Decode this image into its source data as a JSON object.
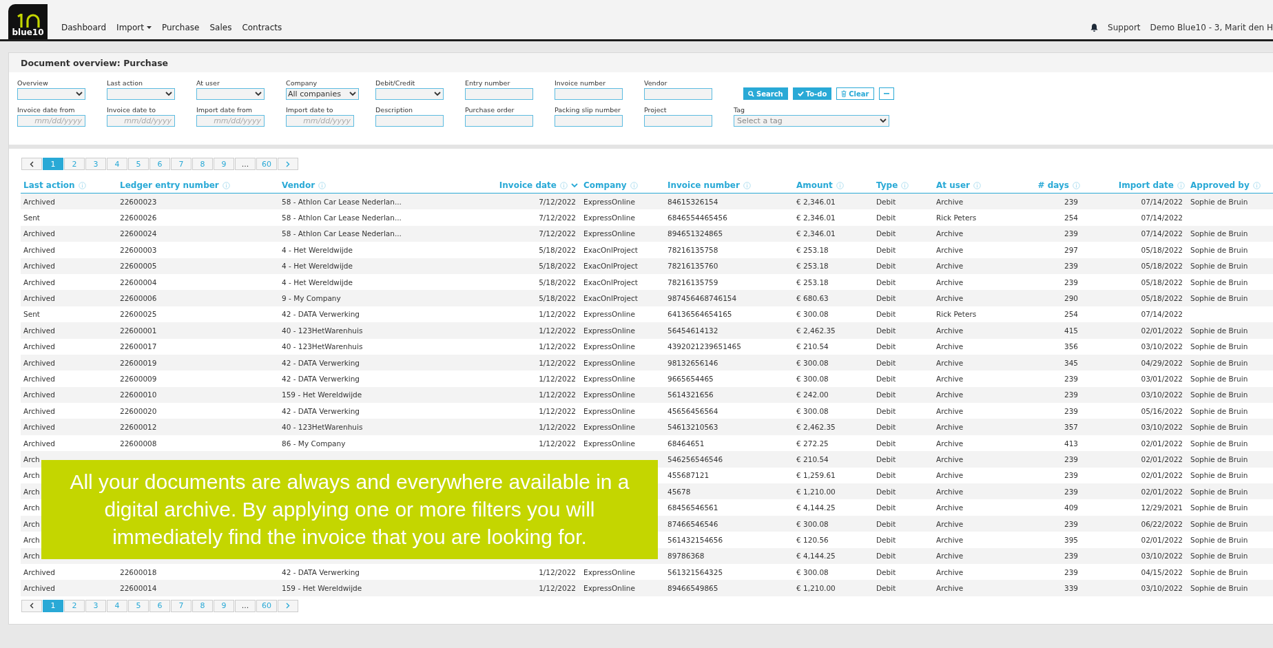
{
  "header": {
    "logo_text": "blue10",
    "nav": [
      {
        "label": "Dashboard",
        "kind": "link"
      },
      {
        "label": "Import",
        "kind": "dropdown"
      },
      {
        "label": "Purchase",
        "kind": "link"
      },
      {
        "label": "Sales",
        "kind": "link"
      },
      {
        "label": "Contracts",
        "kind": "link"
      }
    ],
    "support": "Support",
    "user": "Demo Blue10 - 3, Marit den H"
  },
  "panel_title": "Document overview: Purchase",
  "filter_rows": [
    [
      {
        "label": "Overview",
        "kind": "select"
      },
      {
        "label": "Last action",
        "kind": "select"
      },
      {
        "label": "At user",
        "kind": "select"
      },
      {
        "label": "Company",
        "kind": "select",
        "value": "All companies"
      },
      {
        "label": "Debit/Credit",
        "kind": "select"
      },
      {
        "label": "Entry number",
        "kind": "text"
      },
      {
        "label": "Invoice number",
        "kind": "text"
      },
      {
        "label": "Vendor",
        "kind": "text"
      }
    ],
    [
      {
        "label": "Invoice date from",
        "kind": "date",
        "placeholder": "mm/dd/yyyy"
      },
      {
        "label": "Invoice date to",
        "kind": "date",
        "placeholder": "mm/dd/yyyy"
      },
      {
        "label": "Import date from",
        "kind": "date",
        "placeholder": "mm/dd/yyyy"
      },
      {
        "label": "Import date to",
        "kind": "date",
        "placeholder": "mm/dd/yyyy"
      },
      {
        "label": "Description",
        "kind": "text"
      },
      {
        "label": "Purchase order",
        "kind": "text"
      },
      {
        "label": "Packing slip number",
        "kind": "text"
      },
      {
        "label": "Project",
        "kind": "text"
      },
      {
        "label": "Tag",
        "kind": "tag",
        "placeholder": "Select a tag"
      }
    ]
  ],
  "buttons": [
    {
      "label": "Search",
      "kind": "search"
    },
    {
      "label": "To-do",
      "kind": "todo"
    },
    {
      "label": "Clear",
      "kind": "clear"
    },
    {
      "kind": "collapse"
    }
  ],
  "pagination_top": [
    {
      "kind": "prev"
    },
    {
      "kind": "page",
      "label": "1",
      "selected": true
    },
    {
      "kind": "page",
      "label": "2",
      "selected": false
    },
    {
      "kind": "page",
      "label": "3",
      "selected": false
    },
    {
      "kind": "page",
      "label": "4",
      "selected": false
    },
    {
      "kind": "page",
      "label": "5",
      "selected": false
    },
    {
      "kind": "page",
      "label": "6",
      "selected": false
    },
    {
      "kind": "page",
      "label": "7",
      "selected": false
    },
    {
      "kind": "page",
      "label": "8",
      "selected": false
    },
    {
      "kind": "page",
      "label": "9",
      "selected": false
    },
    {
      "kind": "ellipsis",
      "label": "..."
    },
    {
      "kind": "page",
      "label": "60",
      "selected": false
    },
    {
      "kind": "next"
    }
  ],
  "table": {
    "columns": [
      {
        "label": "Last action",
        "sorted": false
      },
      {
        "label": "Ledger entry number",
        "sorted": false
      },
      {
        "label": "Vendor",
        "sorted": false
      },
      {
        "label": "Invoice date",
        "sorted": true
      },
      {
        "label": "Company",
        "sorted": false
      },
      {
        "label": "Invoice number",
        "sorted": false
      },
      {
        "label": "Amount",
        "sorted": false
      },
      {
        "label": "Type",
        "sorted": false
      },
      {
        "label": "At user",
        "sorted": false
      },
      {
        "label": "# days",
        "sorted": false
      },
      {
        "label": "Import date",
        "sorted": false
      },
      {
        "label": "Approved by",
        "sorted": false
      }
    ],
    "rows": [
      [
        "Archived",
        "22600023",
        "58 - Athlon Car Lease Nederlan...",
        "7/12/2022",
        "ExpressOnline",
        "84615326154",
        "€ 2,346.01",
        "Debit",
        "Archive",
        "239",
        "07/14/2022",
        "Sophie de Bruin"
      ],
      [
        "Sent",
        "22600026",
        "58 - Athlon Car Lease Nederlan...",
        "7/12/2022",
        "ExpressOnline",
        "6846554465456",
        "€ 2,346.01",
        "Debit",
        "Rick Peters",
        "254",
        "07/14/2022",
        null
      ],
      [
        "Archived",
        "22600024",
        "58 - Athlon Car Lease Nederlan...",
        "7/12/2022",
        "ExpressOnline",
        "894651324865",
        "€ 2,346.01",
        "Debit",
        "Archive",
        "239",
        "07/14/2022",
        "Sophie de Bruin"
      ],
      [
        "Archived",
        "22600003",
        "4 - Het Wereldwijde",
        "5/18/2022",
        "ExacOnlProject",
        "78216135758",
        "€ 253.18",
        "Debit",
        "Archive",
        "297",
        "05/18/2022",
        "Sophie de Bruin"
      ],
      [
        "Archived",
        "22600005",
        "4 - Het Wereldwijde",
        "5/18/2022",
        "ExacOnlProject",
        "78216135760",
        "€ 253.18",
        "Debit",
        "Archive",
        "239",
        "05/18/2022",
        "Sophie de Bruin"
      ],
      [
        "Archived",
        "22600004",
        "4 - Het Wereldwijde",
        "5/18/2022",
        "ExacOnlProject",
        "78216135759",
        "€ 253.18",
        "Debit",
        "Archive",
        "239",
        "05/18/2022",
        "Sophie de Bruin"
      ],
      [
        "Archived",
        "22600006",
        "9 - My Company",
        "5/18/2022",
        "ExacOnlProject",
        "987456468746154",
        "€ 680.63",
        "Debit",
        "Archive",
        "290",
        "05/18/2022",
        "Sophie de Bruin"
      ],
      [
        "Sent",
        "22600025",
        "42 - DATA Verwerking",
        "1/12/2022",
        "ExpressOnline",
        "64136564654165",
        "€ 300.08",
        "Debit",
        "Rick Peters",
        "254",
        "07/14/2022",
        null
      ],
      [
        "Archived",
        "22600001",
        "40 - 123HetWarenhuis",
        "1/12/2022",
        "ExpressOnline",
        "56454614132",
        "€ 2,462.35",
        "Debit",
        "Archive",
        "415",
        "02/01/2022",
        "Sophie de Bruin"
      ],
      [
        "Archived",
        "22600017",
        "40 - 123HetWarenhuis",
        "1/12/2022",
        "ExpressOnline",
        "4392021239651465",
        "€ 210.54",
        "Debit",
        "Archive",
        "356",
        "03/10/2022",
        "Sophie de Bruin"
      ],
      [
        "Archived",
        "22600019",
        "42 - DATA Verwerking",
        "1/12/2022",
        "ExpressOnline",
        "98132656146",
        "€ 300.08",
        "Debit",
        "Archive",
        "345",
        "04/29/2022",
        "Sophie de Bruin"
      ],
      [
        "Archived",
        "22600009",
        "42 - DATA Verwerking",
        "1/12/2022",
        "ExpressOnline",
        "9665654465",
        "€ 300.08",
        "Debit",
        "Archive",
        "239",
        "03/01/2022",
        "Sophie de Bruin"
      ],
      [
        "Archived",
        "22600010",
        "159 - Het Wereldwijde",
        "1/12/2022",
        "ExpressOnline",
        "5614321656",
        "€ 242.00",
        "Debit",
        "Archive",
        "239",
        "03/10/2022",
        "Sophie de Bruin"
      ],
      [
        "Archived",
        "22600020",
        "42 - DATA Verwerking",
        "1/12/2022",
        "ExpressOnline",
        "45656456564",
        "€ 300.08",
        "Debit",
        "Archive",
        "239",
        "05/16/2022",
        "Sophie de Bruin"
      ],
      [
        "Archived",
        "22600012",
        "40 - 123HetWarenhuis",
        "1/12/2022",
        "ExpressOnline",
        "54613210563",
        "€ 2,462.35",
        "Debit",
        "Archive",
        "357",
        "03/10/2022",
        "Sophie de Bruin"
      ],
      [
        "Archived",
        "22600008",
        "86 - My Company",
        "1/12/2022",
        "ExpressOnline",
        "68464651",
        "€ 272.25",
        "Debit",
        "Archive",
        "413",
        "02/01/2022",
        "Sophie de Bruin"
      ],
      [
        "Arch",
        null,
        null,
        null,
        null,
        "546256546546",
        "€ 210.54",
        "Debit",
        "Archive",
        "239",
        "02/01/2022",
        "Sophie de Bruin"
      ],
      [
        "Arch",
        null,
        null,
        null,
        null,
        "455687121",
        "€ 1,259.61",
        "Debit",
        "Archive",
        "239",
        "02/01/2022",
        "Sophie de Bruin"
      ],
      [
        "Arch",
        null,
        null,
        null,
        null,
        "45678",
        "€ 1,210.00",
        "Debit",
        "Archive",
        "239",
        "02/01/2022",
        "Sophie de Bruin"
      ],
      [
        "Arch",
        null,
        null,
        null,
        null,
        "68456546561",
        "€ 4,144.25",
        "Debit",
        "Archive",
        "409",
        "12/29/2021",
        "Sophie de Bruin"
      ],
      [
        "Arch",
        null,
        null,
        null,
        null,
        "87466546546",
        "€ 300.08",
        "Debit",
        "Archive",
        "239",
        "06/22/2022",
        "Sophie de Bruin"
      ],
      [
        "Arch",
        null,
        null,
        null,
        null,
        "561432154656",
        "€ 120.56",
        "Debit",
        "Archive",
        "395",
        "02/01/2022",
        "Sophie de Bruin"
      ],
      [
        "Arch",
        null,
        null,
        null,
        null,
        "89786368",
        "€ 4,144.25",
        "Debit",
        "Archive",
        "239",
        "03/10/2022",
        "Sophie de Bruin"
      ],
      [
        "Archived",
        "22600018",
        "42 - DATA Verwerking",
        "1/12/2022",
        "ExpressOnline",
        "561321564325",
        "€ 300.08",
        "Debit",
        "Archive",
        "239",
        "04/15/2022",
        "Sophie de Bruin"
      ],
      [
        "Archived",
        "22600014",
        "159 - Het Wereldwijde",
        "1/12/2022",
        "ExpressOnline",
        "89466549865",
        "€ 1,210.00",
        "Debit",
        "Archive",
        "339",
        "03/10/2022",
        "Sophie de Bruin"
      ]
    ]
  },
  "caption": "All your documents are always and everywhere available in a digital archive. By applying one or more filters you will immediately find the invoice that you are looking for.",
  "pagination_bottom": [
    {
      "kind": "prev"
    },
    {
      "kind": "page",
      "label": "1",
      "selected": true
    },
    {
      "kind": "page",
      "label": "2",
      "selected": false
    },
    {
      "kind": "page",
      "label": "3",
      "selected": false
    },
    {
      "kind": "page",
      "label": "4",
      "selected": false
    },
    {
      "kind": "page",
      "label": "5",
      "selected": false
    },
    {
      "kind": "page",
      "label": "6",
      "selected": false
    },
    {
      "kind": "page",
      "label": "7",
      "selected": false
    },
    {
      "kind": "page",
      "label": "8",
      "selected": false
    },
    {
      "kind": "page",
      "label": "9",
      "selected": false
    },
    {
      "kind": "ellipsis",
      "label": "..."
    },
    {
      "kind": "page",
      "label": "60",
      "selected": false
    },
    {
      "kind": "next"
    }
  ]
}
